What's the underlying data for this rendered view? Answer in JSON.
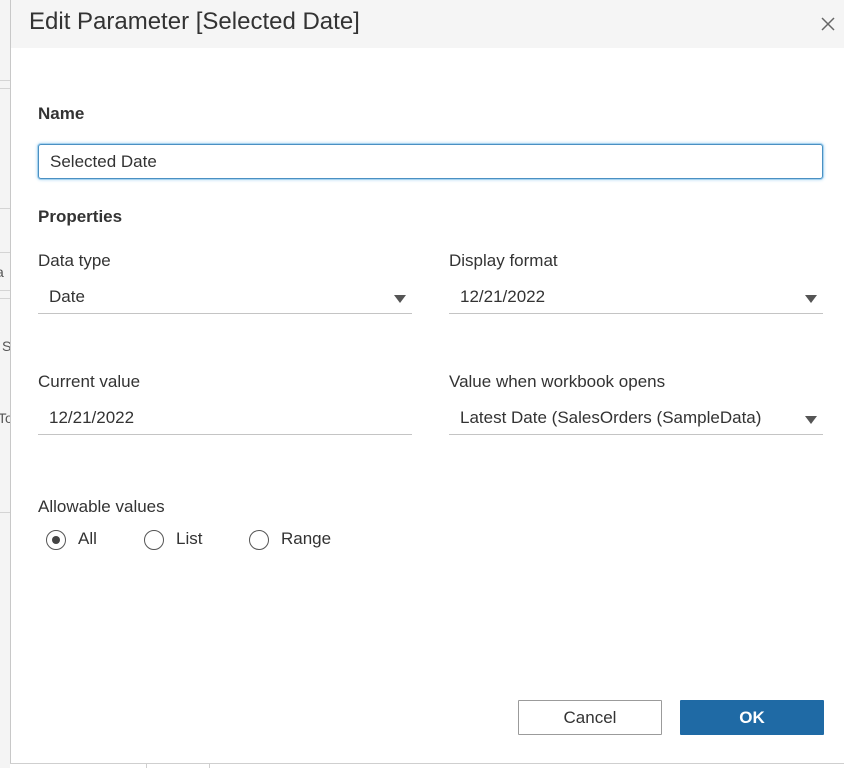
{
  "background": {
    "fragments": [
      "a",
      "S",
      "To"
    ]
  },
  "dialog": {
    "title": "Edit Parameter [Selected Date]",
    "close_icon": "close-icon",
    "name": {
      "label": "Name",
      "value": "Selected Date"
    },
    "properties_label": "Properties",
    "data_type": {
      "label": "Data type",
      "value": "Date"
    },
    "display_format": {
      "label": "Display format",
      "value": "12/21/2022"
    },
    "current_value": {
      "label": "Current value",
      "value": "12/21/2022"
    },
    "value_when_opens": {
      "label": "Value when workbook opens",
      "value": "Latest Date (SalesOrders (SampleData)"
    },
    "allowable_values": {
      "label": "Allowable values",
      "options": [
        "All",
        "List",
        "Range"
      ],
      "selected": "All"
    },
    "buttons": {
      "cancel": "Cancel",
      "ok": "OK"
    },
    "colors": {
      "primary": "#1f6aa5",
      "focus_border": "#4a90c2",
      "title_bar": "#f5f5f5"
    }
  }
}
